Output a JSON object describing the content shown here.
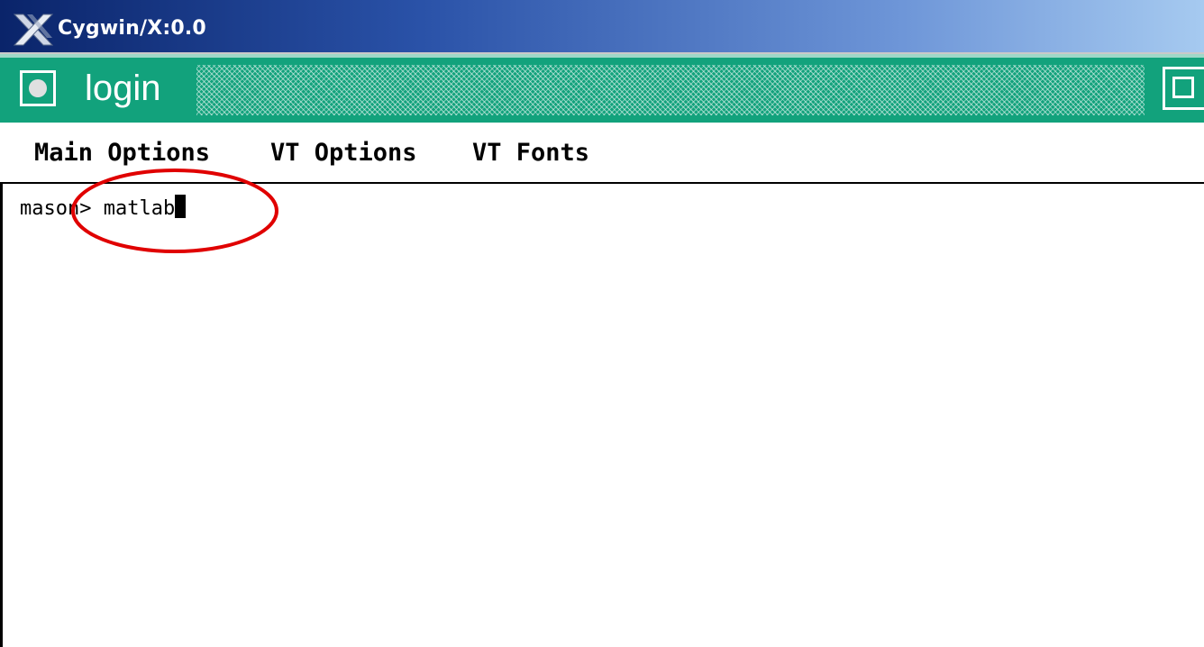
{
  "window": {
    "title": "Cygwin/X:0.0",
    "title_bar_color": "#0a246a"
  },
  "frame": {
    "name": "login",
    "color": "#12a27c"
  },
  "menubar": {
    "items": [
      {
        "label": "Main Options"
      },
      {
        "label": "VT Options"
      },
      {
        "label": "VT Fonts"
      }
    ]
  },
  "terminal": {
    "prompt": "mason> ",
    "command": "matlab"
  },
  "annotation": {
    "shape": "ellipse",
    "color": "#e00000"
  }
}
